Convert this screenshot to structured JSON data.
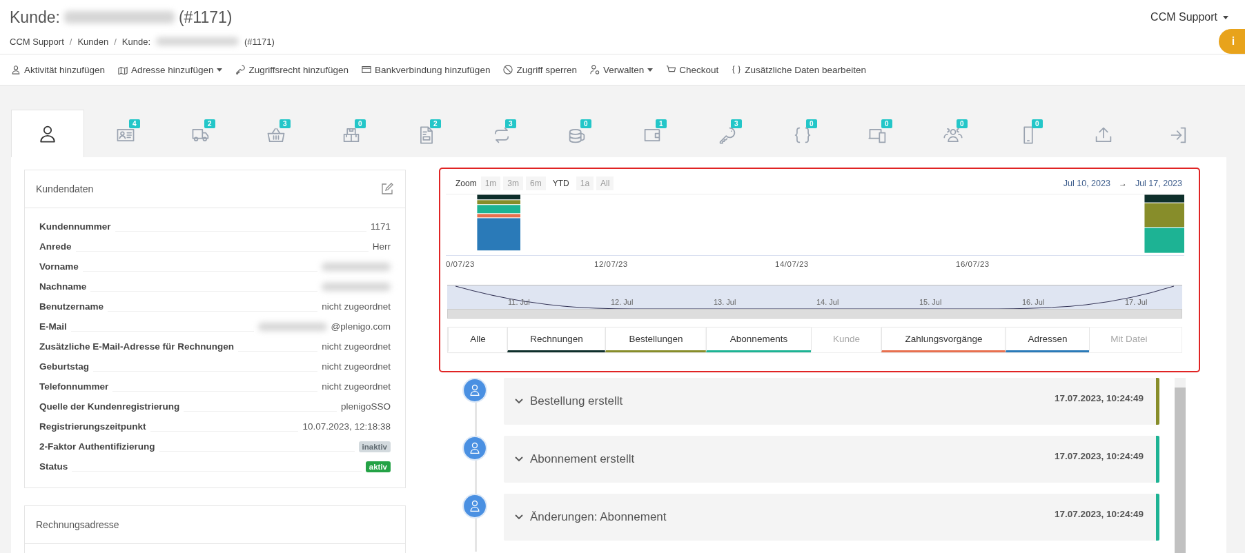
{
  "header": {
    "title_prefix": "Kunde:",
    "title_suffix": "(#1171)",
    "user_menu": "CCM Support",
    "info_badge": "i"
  },
  "breadcrumbs": [
    {
      "label": "CCM Support"
    },
    {
      "separator": "/",
      "label": "Kunden"
    },
    {
      "separator": "/",
      "label": "Kunde:",
      "suffix": "(#1171)"
    }
  ],
  "toolbar": [
    {
      "label": "Aktivität hinzufügen",
      "dropdown": false
    },
    {
      "label": "Adresse hinzufügen",
      "dropdown": true
    },
    {
      "label": "Zugriffsrecht hinzufügen",
      "dropdown": false
    },
    {
      "label": "Bankverbindung hinzufügen",
      "dropdown": false
    },
    {
      "label": "Zugriff sperren",
      "dropdown": false
    },
    {
      "label": "Verwalten",
      "dropdown": true
    },
    {
      "label": "Checkout",
      "dropdown": false
    },
    {
      "label": "Zusätzliche Daten bearbeiten",
      "dropdown": false
    }
  ],
  "tabs": [
    {
      "selected": true
    },
    {
      "badge": "4",
      "selected": false
    },
    {
      "badge": "2",
      "selected": false
    },
    {
      "badge": "3",
      "selected": false
    },
    {
      "badge": "0",
      "selected": false
    },
    {
      "badge": "2",
      "selected": false
    },
    {
      "badge": "3",
      "selected": false
    },
    {
      "badge": "0",
      "selected": false
    },
    {
      "badge": "1",
      "selected": false
    },
    {
      "badge": "3",
      "selected": false
    },
    {
      "badge": "0",
      "selected": false
    },
    {
      "badge": "0",
      "selected": false
    },
    {
      "badge": "0",
      "selected": false
    },
    {
      "badge": "0",
      "selected": false
    },
    {
      "selected": false
    },
    {
      "selected": false
    }
  ],
  "customer_card": {
    "title": "Kundendaten",
    "rows": [
      {
        "label": "Kundennummer",
        "value": "1171"
      },
      {
        "label": "Anrede",
        "value": "Herr"
      },
      {
        "label": "Vorname",
        "redacted": true
      },
      {
        "label": "Nachname",
        "redacted": true
      },
      {
        "label": "Benutzername",
        "value": "nicht zugeordnet"
      },
      {
        "label": "E-Mail",
        "value": "@plenigo.com",
        "redacted": true
      },
      {
        "label": "Zusätzliche E-Mail-Adresse für Rechnungen",
        "value": "nicht zugeordnet"
      },
      {
        "label": "Geburtstag",
        "value": "nicht zugeordnet"
      },
      {
        "label": "Telefonnummer",
        "value": "nicht zugeordnet"
      },
      {
        "label": "Quelle der Kundenregistrierung",
        "value": "plenigoSSO"
      },
      {
        "label": "Registrierungszeitpunkt",
        "value": "10.07.2023, 12:18:38"
      },
      {
        "label": "2-Faktor Authentifizierung",
        "badge": "inaktiv",
        "active": false
      },
      {
        "label": "Status",
        "badge": "aktiv",
        "active": true
      }
    ]
  },
  "address_card": {
    "title": "Rechnungsadresse"
  },
  "chart": {
    "zoom_label": "Zoom",
    "zoom_buttons": [
      {
        "label": "1m",
        "selected": false
      },
      {
        "label": "3m",
        "selected": false
      },
      {
        "label": "6m",
        "selected": false
      },
      {
        "label": "YTD",
        "selected": true
      },
      {
        "label": "1a",
        "selected": false
      },
      {
        "label": "All",
        "selected": false
      }
    ],
    "range_from": "Jul 10, 2023",
    "range_sep": "→",
    "range_to": "Jul 17, 2023",
    "x_labels": [
      "0/07/23",
      "12/07/23",
      "14/07/23",
      "16/07/23"
    ],
    "navigator_labels": [
      "11. Jul",
      "12. Jul",
      "13. Jul",
      "14. Jul",
      "15. Jul",
      "16. Jul",
      "17. Jul"
    ],
    "filters": [
      {
        "label": "Alle",
        "disabled": false
      },
      {
        "label": "Rechnungen",
        "disabled": false,
        "color": "#0e2f2b"
      },
      {
        "label": "Bestellungen",
        "disabled": false,
        "color": "#878d2a"
      },
      {
        "label": "Abonnements",
        "disabled": false,
        "color": "#1db394"
      },
      {
        "label": "Kunde",
        "disabled": true
      },
      {
        "label": "Zahlungsvorgänge",
        "disabled": false,
        "color": "#e8704f"
      },
      {
        "label": "Adressen",
        "disabled": false,
        "color": "#2a7ab8"
      },
      {
        "label": "Mit Datei",
        "disabled": true
      }
    ]
  },
  "timeline": [
    {
      "title": "Bestellung erstellt",
      "time": "17.07.2023, 10:24:49",
      "color": "#878d2a"
    },
    {
      "title": "Abonnement erstellt",
      "time": "17.07.2023, 10:24:49",
      "color": "#1db394"
    },
    {
      "title": "Änderungen: Abonnement",
      "time": "17.07.2023, 10:24:49",
      "color": "#1db394"
    }
  ]
}
